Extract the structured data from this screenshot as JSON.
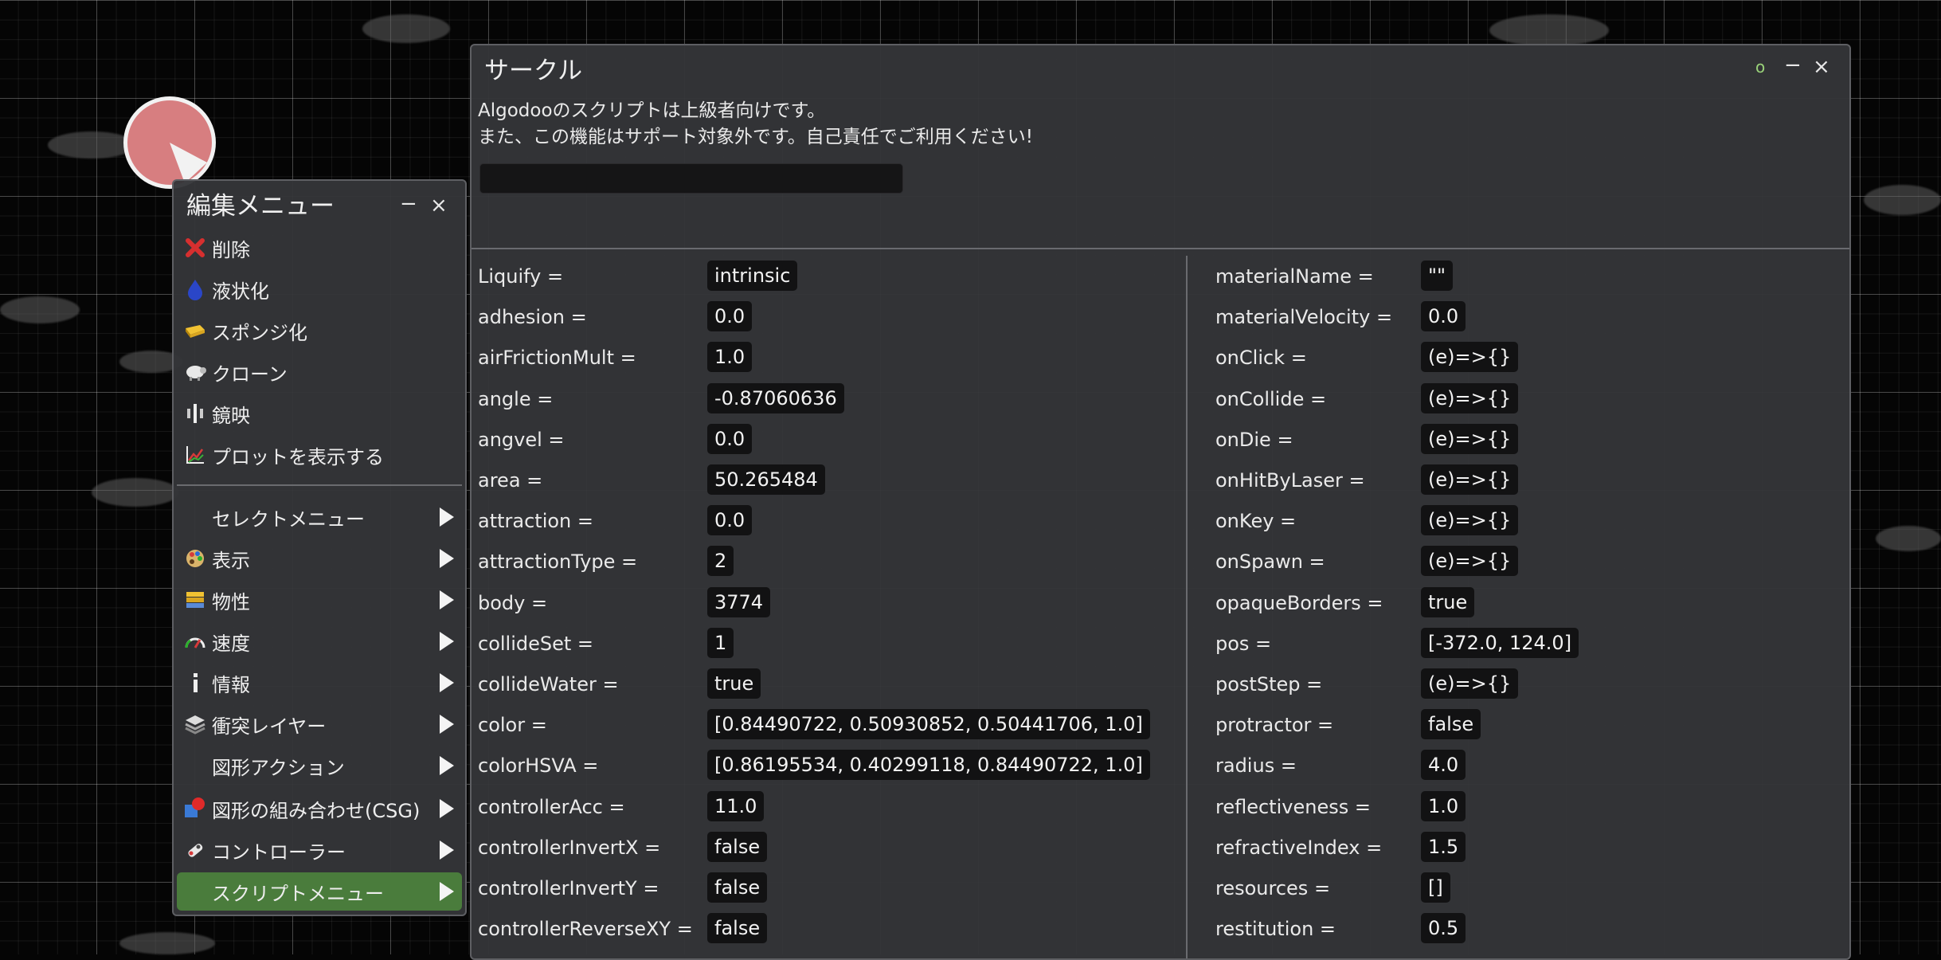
{
  "colors": {
    "circle_fill": "#d77e80",
    "panel_bg": "#343538",
    "active_item": "#4a7c3c",
    "value_bg": "#121213"
  },
  "edit_menu": {
    "title": "編集メニュー",
    "minimize": "−",
    "close": "×",
    "items": [
      {
        "label": "削除",
        "icon": "delete-x-icon"
      },
      {
        "label": "液状化",
        "icon": "water-drop-icon"
      },
      {
        "label": "スポンジ化",
        "icon": "sponge-icon"
      },
      {
        "label": "クローン",
        "icon": "sheep-icon"
      },
      {
        "label": "鏡映",
        "icon": "mirror-icon"
      },
      {
        "label": "プロットを表示する",
        "icon": "plot-icon"
      }
    ],
    "submenus": [
      {
        "label": "セレクトメニュー",
        "icon": ""
      },
      {
        "label": "表示",
        "icon": "palette-icon"
      },
      {
        "label": "物性",
        "icon": "material-icon"
      },
      {
        "label": "速度",
        "icon": "speedometer-icon"
      },
      {
        "label": "情報",
        "icon": "info-icon"
      },
      {
        "label": "衝突レイヤー",
        "icon": "layers-icon"
      },
      {
        "label": "図形アクション",
        "icon": ""
      },
      {
        "label": "図形の組み合わせ(CSG)",
        "icon": "csg-icon"
      },
      {
        "label": "コントローラー",
        "icon": "controller-icon"
      },
      {
        "label": "スクリプトメニュー",
        "icon": "",
        "active": true
      }
    ]
  },
  "script_window": {
    "title": "サークル",
    "status_dot": "o",
    "minimize": "−",
    "close": "×",
    "notice_line1": "Algodooのスクリプトは上級者向けです。",
    "notice_line2": "また、この機能はサポート対象外です。自己責任でご利用ください!",
    "command_value": "",
    "left_props": [
      {
        "key": "Liquify =",
        "value": "intrinsic"
      },
      {
        "key": "adhesion =",
        "value": "0.0"
      },
      {
        "key": "airFrictionMult =",
        "value": "1.0"
      },
      {
        "key": "angle =",
        "value": "-0.87060636"
      },
      {
        "key": "angvel =",
        "value": "0.0"
      },
      {
        "key": "area =",
        "value": "50.265484"
      },
      {
        "key": "attraction =",
        "value": "0.0"
      },
      {
        "key": "attractionType =",
        "value": "2"
      },
      {
        "key": "body =",
        "value": "3774"
      },
      {
        "key": "collideSet =",
        "value": "1"
      },
      {
        "key": "collideWater =",
        "value": "true"
      },
      {
        "key": "color =",
        "value": "[0.84490722, 0.50930852, 0.50441706, 1.0]"
      },
      {
        "key": "colorHSVA =",
        "value": "[0.86195534, 0.40299118, 0.84490722, 1.0]"
      },
      {
        "key": "controllerAcc =",
        "value": "11.0"
      },
      {
        "key": "controllerInvertX =",
        "value": "false"
      },
      {
        "key": "controllerInvertY =",
        "value": "false"
      },
      {
        "key": "controllerReverseXY =",
        "value": "false"
      }
    ],
    "right_props": [
      {
        "key": "materialName =",
        "value": "\"\""
      },
      {
        "key": "materialVelocity =",
        "value": "0.0"
      },
      {
        "key": "onClick =",
        "value": "(e)=>{}"
      },
      {
        "key": "onCollide =",
        "value": "(e)=>{}"
      },
      {
        "key": "onDie =",
        "value": "(e)=>{}"
      },
      {
        "key": "onHitByLaser =",
        "value": "(e)=>{}"
      },
      {
        "key": "onKey =",
        "value": "(e)=>{}"
      },
      {
        "key": "onSpawn =",
        "value": "(e)=>{}"
      },
      {
        "key": "opaqueBorders =",
        "value": "true"
      },
      {
        "key": "pos =",
        "value": "[-372.0, 124.0]"
      },
      {
        "key": "postStep =",
        "value": "(e)=>{}"
      },
      {
        "key": "protractor =",
        "value": "false"
      },
      {
        "key": "radius =",
        "value": "4.0"
      },
      {
        "key": "reflectiveness =",
        "value": "1.0"
      },
      {
        "key": "refractiveIndex =",
        "value": "1.5"
      },
      {
        "key": "resources =",
        "value": "[]"
      },
      {
        "key": "restitution =",
        "value": "0.5"
      }
    ]
  }
}
